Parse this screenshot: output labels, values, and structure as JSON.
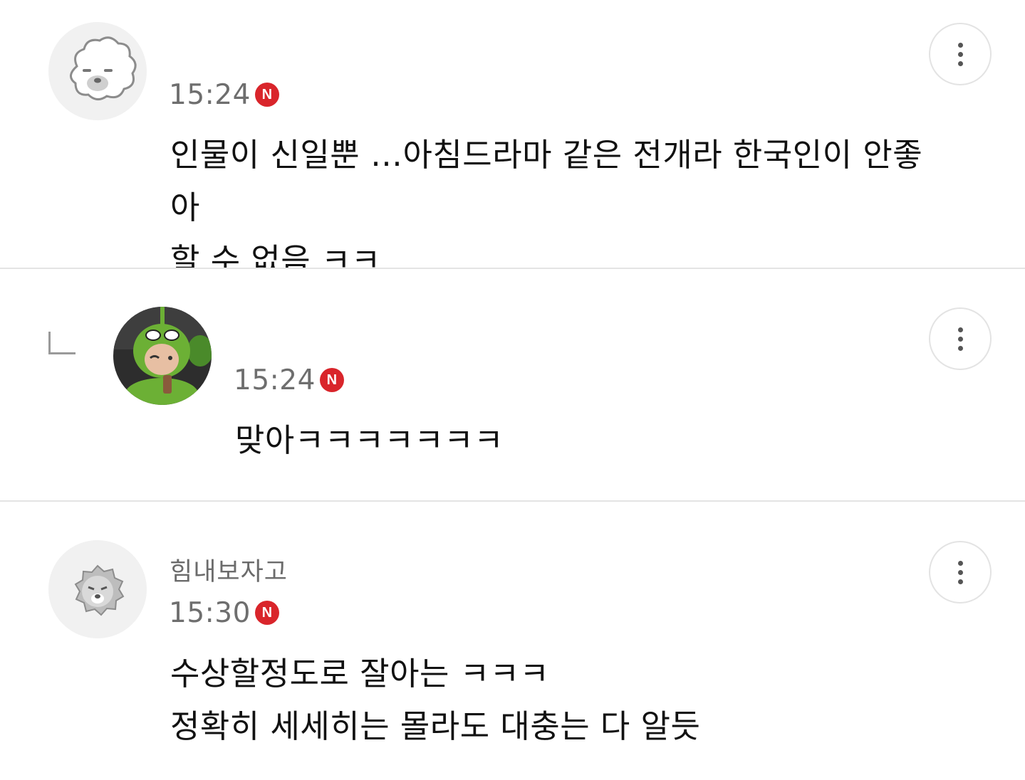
{
  "comments": [
    {
      "avatar_icon": "fluffy-dog-icon",
      "nickname": "",
      "time": "15:24",
      "new_badge": "N",
      "text": "인물이 신일뿐 …아침드라마 같은 전개라 한국인이 안좋아\n할 수 없음 ㅋㅋ",
      "is_reply": false
    },
    {
      "avatar_icon": "green-doll-photo",
      "nickname": "",
      "time": "15:24",
      "new_badge": "N",
      "text": "맞아ㅋㅋㅋㅋㅋㅋㅋ",
      "is_reply": true
    },
    {
      "avatar_icon": "lion-face-icon",
      "nickname": "힘내보자고",
      "time": "15:30",
      "new_badge": "N",
      "text": "수상할정도로 잘아는 ㅋㅋㅋ\n정확히 세세히는 몰라도 대충는 다 알듯",
      "is_reply": false
    }
  ],
  "colors": {
    "badge_red": "#d9252b",
    "time_gray": "#6e6e6e",
    "divider": "#e4e4e4"
  }
}
